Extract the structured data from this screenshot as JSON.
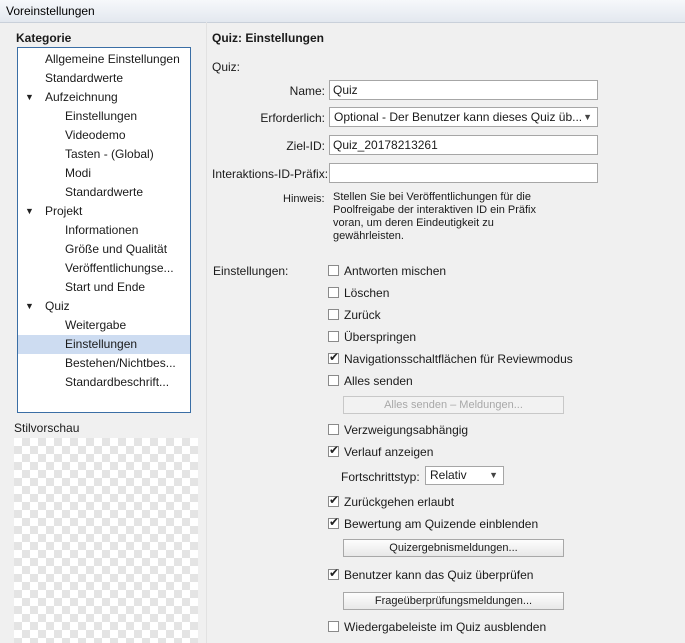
{
  "window": {
    "title": "Voreinstellungen"
  },
  "sidebar": {
    "title": "Kategorie",
    "items": [
      {
        "label": "Allgemeine Einstellungen",
        "level": 0,
        "arrow": ""
      },
      {
        "label": "Standardwerte",
        "level": 0,
        "arrow": ""
      },
      {
        "label": "Aufzeichnung",
        "level": 0,
        "arrow": "▼"
      },
      {
        "label": "Einstellungen",
        "level": 1,
        "arrow": ""
      },
      {
        "label": "Videodemo",
        "level": 1,
        "arrow": ""
      },
      {
        "label": "Tasten - (Global)",
        "level": 1,
        "arrow": ""
      },
      {
        "label": "Modi",
        "level": 1,
        "arrow": ""
      },
      {
        "label": "Standardwerte",
        "level": 1,
        "arrow": ""
      },
      {
        "label": "Projekt",
        "level": 0,
        "arrow": "▼"
      },
      {
        "label": "Informationen",
        "level": 1,
        "arrow": ""
      },
      {
        "label": "Größe und Qualität",
        "level": 1,
        "arrow": ""
      },
      {
        "label": "Veröffentlichungse...",
        "level": 1,
        "arrow": ""
      },
      {
        "label": "Start und Ende",
        "level": 1,
        "arrow": ""
      },
      {
        "label": "Quiz",
        "level": 0,
        "arrow": "▼"
      },
      {
        "label": "Weitergabe",
        "level": 1,
        "arrow": ""
      },
      {
        "label": "Einstellungen",
        "level": 1,
        "arrow": "",
        "selected": true
      },
      {
        "label": "Bestehen/Nichtbes...",
        "level": 1,
        "arrow": ""
      },
      {
        "label": "Standardbeschrift...",
        "level": 1,
        "arrow": ""
      }
    ],
    "preview_label": "Stilvorschau"
  },
  "main": {
    "heading": "Quiz: Einstellungen",
    "section_label": "Quiz:",
    "name": {
      "label": "Name:",
      "value": "Quiz"
    },
    "required": {
      "label": "Erforderlich:",
      "value": "Optional - Der Benutzer kann dieses Quiz üb..."
    },
    "target_id": {
      "label": "Ziel-ID:",
      "value": "Quiz_20178213261"
    },
    "interaction_prefix": {
      "label": "Interaktions-ID-Präfix:",
      "value": ""
    },
    "hint": {
      "label": "Hinweis:",
      "text": "Stellen Sie bei Veröffentlichungen für die Poolfreigabe der interaktiven ID ein Präfix voran, um deren Eindeutigkeit zu gewährleisten."
    },
    "settings_label": "Einstellungen:",
    "checkboxes": [
      {
        "label": "Antworten mischen",
        "checked": false
      },
      {
        "label": "Löschen",
        "checked": false
      },
      {
        "label": "Zurück",
        "checked": false
      },
      {
        "label": "Überspringen",
        "checked": false
      },
      {
        "label": "Navigationsschaltflächen für Reviewmodus",
        "checked": true
      },
      {
        "label": "Alles senden",
        "checked": false
      },
      {
        "label": "Verzweigungsabhängig",
        "checked": false
      },
      {
        "label": "Verlauf anzeigen",
        "checked": true
      },
      {
        "label": "Zurückgehen erlaubt",
        "checked": true
      },
      {
        "label": "Bewertung am Quizende einblenden",
        "checked": true
      },
      {
        "label": "Benutzer kann das Quiz überprüfen",
        "checked": true
      },
      {
        "label": "Wiedergabeleiste im Quiz ausblenden",
        "checked": false
      }
    ],
    "send_all_messages_button": "Alles senden – Meldungen...",
    "progress": {
      "label": "Fortschrittstyp:",
      "value": "Relativ"
    },
    "quiz_result_messages_button": "Quizergebnismeldungen...",
    "question_review_messages_button": "Frageüberprüfungsmeldungen..."
  },
  "icons": {
    "checkmark": "✔",
    "dropdown": "▼",
    "tree_expanded": "▼"
  }
}
